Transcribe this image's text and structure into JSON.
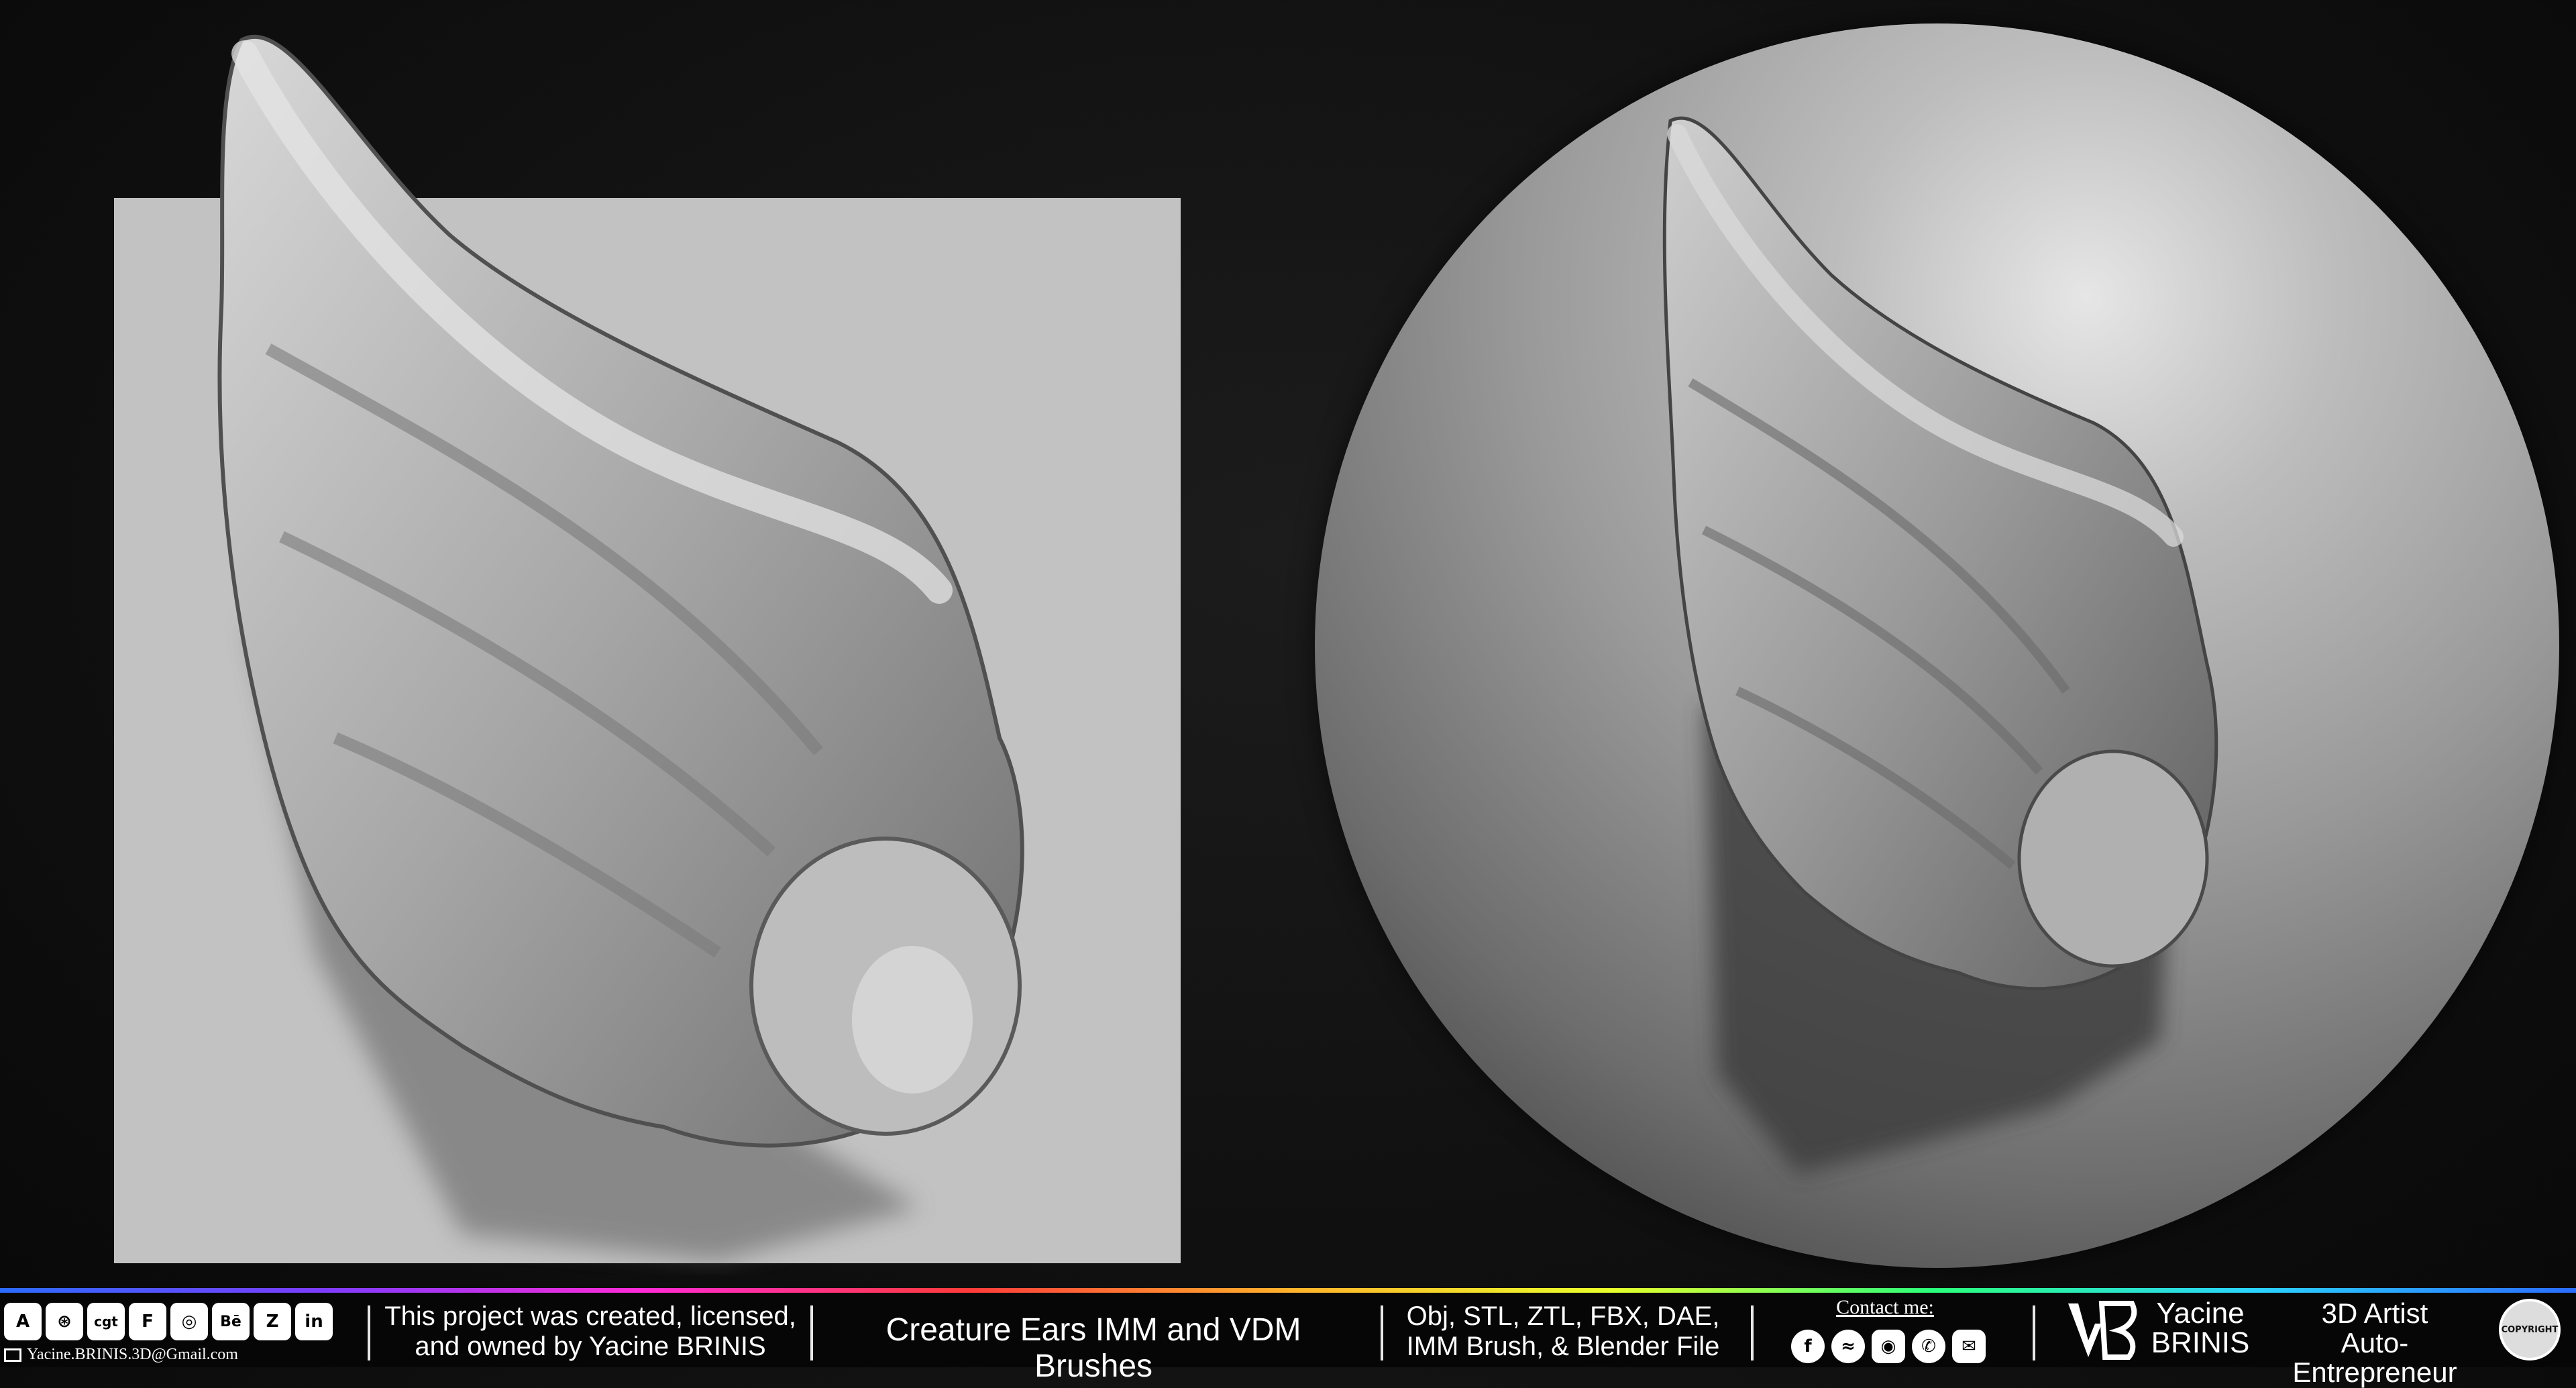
{
  "footer": {
    "social_icons": [
      {
        "name": "artstation-icon",
        "glyph": "A"
      },
      {
        "name": "sketchfab-icon",
        "glyph": "⊛"
      },
      {
        "name": "cgtrader-icon",
        "glyph": "cgt"
      },
      {
        "name": "flippednormals-icon",
        "glyph": "F"
      },
      {
        "name": "turbosquid-icon",
        "glyph": "◎"
      },
      {
        "name": "behance-icon",
        "glyph": "Bē"
      },
      {
        "name": "zbrush-icon",
        "glyph": "Z"
      },
      {
        "name": "linkedin-icon",
        "glyph": "in"
      }
    ],
    "email": "Yacine.BRINIS.3D@Gmail.com",
    "project_line1": "This project was created, licensed,",
    "project_line2": "and owned by Yacine BRINIS",
    "product_title": "Creature Ears IMM and VDM Brushes",
    "formats_line1": "Obj, STL, ZTL, FBX, DAE,",
    "formats_line2": "IMM Brush, & Blender File",
    "contact_label": "Contact me:",
    "contact_icons": [
      {
        "name": "facebook-icon",
        "glyph": "f"
      },
      {
        "name": "messenger-icon",
        "glyph": "≈"
      },
      {
        "name": "instagram-icon",
        "glyph": "◉"
      },
      {
        "name": "whatsapp-icon",
        "glyph": "✆"
      },
      {
        "name": "email-icon",
        "glyph": "✉"
      }
    ],
    "name_first": "Yacine",
    "name_last": "BRINIS",
    "role_line1": "3D Artist",
    "role_line2": "Auto-Entrepreneur",
    "seal_text": "COPYRIGHT"
  },
  "colors": {
    "background": "#111111",
    "flat_panel": "#c2c2c2",
    "sculpt_gray": "#9a9a9a"
  }
}
